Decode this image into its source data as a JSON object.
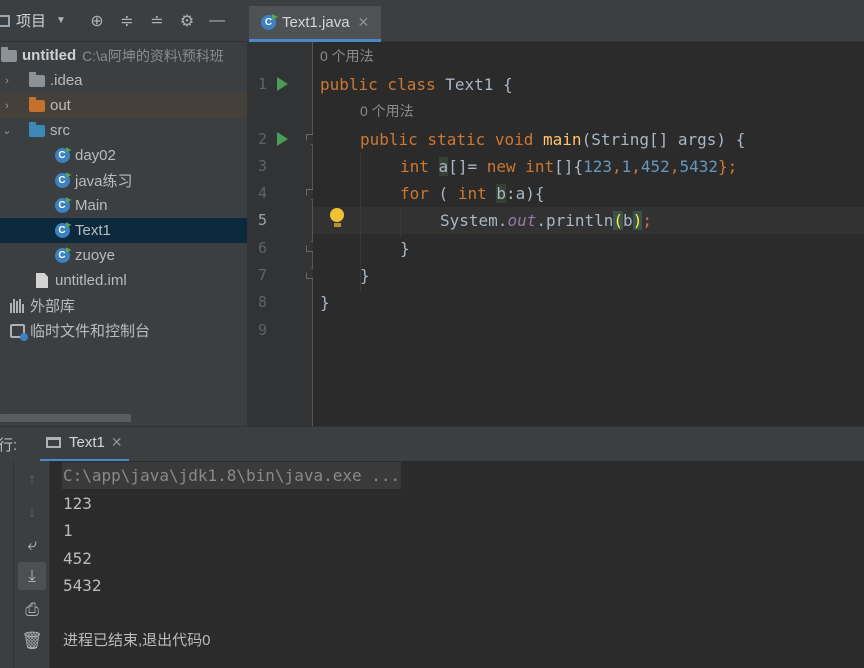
{
  "project_panel": {
    "title": "项目",
    "tree": [
      {
        "label": "untitled",
        "hint": "C:\\a阿坤的资料\\预科班"
      },
      {
        "label": ".idea"
      },
      {
        "label": "out"
      },
      {
        "label": "src"
      },
      {
        "label": "day02"
      },
      {
        "label": "java练习"
      },
      {
        "label": "Main"
      },
      {
        "label": "Text1"
      },
      {
        "label": "zuoye"
      },
      {
        "label": "untitled.iml"
      },
      {
        "label": "外部库"
      },
      {
        "label": "临时文件和控制台"
      }
    ]
  },
  "editor": {
    "tab_label": "Text1.java",
    "usage_hint": "0 个用法",
    "line_numbers": [
      "1",
      "2",
      "3",
      "4",
      "5",
      "6",
      "7",
      "8",
      "9"
    ],
    "code": {
      "l1_kw": "public class",
      "l1_rest": " Text1 {",
      "l2_kw": "public static void",
      "l2_fn": "main",
      "l2_rest": "(String[] args) {",
      "l3_kw1": "int",
      "l3_var": "a",
      "l3_mid": "[]= ",
      "l3_kw2": "new",
      "l3_kw3": "int",
      "l3_br": "[]{",
      "l3_n1": "123",
      "l3_n2": "1",
      "l3_n3": "452",
      "l3_n4": "5432",
      "l3_end": "};",
      "l4_kw1": "for",
      "l4_mid": " ( ",
      "l4_kw2": "int",
      "l4_var": "b",
      "l4_rest": ":a){",
      "l5_a": "System.",
      "l5_fld": "out",
      "l5_b": ".println",
      "l5_p1": "(",
      "l5_arg": "b",
      "l5_p2": ")",
      "l5_end": ";",
      "l6": "}",
      "l7": "}",
      "l8": "}"
    }
  },
  "run_panel": {
    "label": "行:",
    "tab_label": "Text1",
    "console": {
      "command": "C:\\app\\java\\jdk1.8\\bin\\java.exe ...",
      "output": [
        "123",
        "1",
        "452",
        "5432"
      ],
      "exit_message": "进程已结束,退出代码0"
    }
  }
}
